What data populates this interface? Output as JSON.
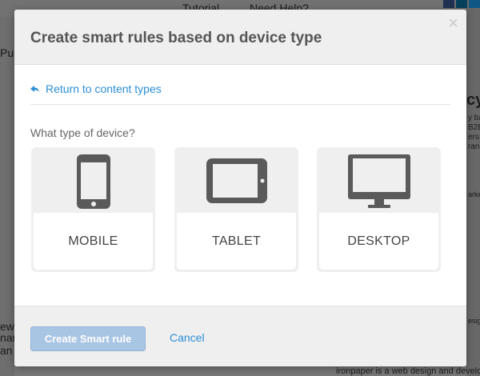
{
  "background": {
    "top_links": [
      "Tutorial",
      "Need Help?"
    ],
    "side_fragments": [
      "Pub",
      "ew",
      "nark",
      "an"
    ],
    "right_fragments": [
      "cy",
      "y ba",
      "B2B",
      "ers,",
      "rand",
      "arketi",
      "esig"
    ],
    "bottom_text": "ironpaper is a web design and developmen"
  },
  "modal": {
    "title": "Create smart rules based on device type",
    "close_label": "×",
    "return_link": "Return to content types",
    "question": "What type of device?",
    "devices": [
      {
        "label": "MOBILE",
        "icon": "mobile-phone-icon"
      },
      {
        "label": "TABLET",
        "icon": "tablet-icon"
      },
      {
        "label": "DESKTOP",
        "icon": "desktop-monitor-icon"
      }
    ],
    "footer": {
      "create_button": "Create Smart rule",
      "cancel_link": "Cancel"
    }
  },
  "colors": {
    "link": "#2a8fd6",
    "icon": "#5a5a5a",
    "button_disabled": "#a9c5e4"
  }
}
